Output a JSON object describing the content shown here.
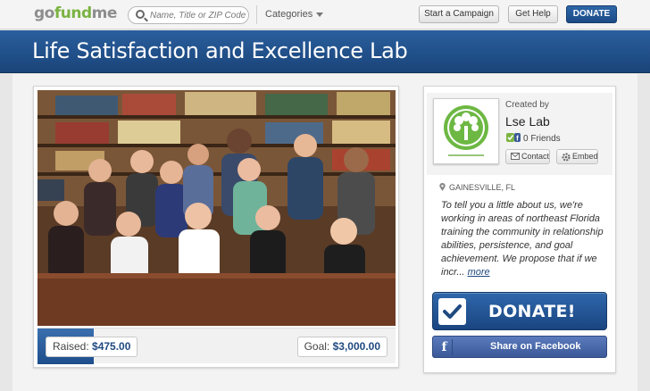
{
  "header": {
    "logo_text_1": "go",
    "logo_text_2": "fund",
    "logo_text_3": "me",
    "search_placeholder": "Name, Title or ZIP Code...",
    "categories_label": "Categories",
    "start_campaign_label": "Start a Campaign",
    "get_help_label": "Get Help",
    "donate_label": "DONATE"
  },
  "campaign": {
    "title": "Life Satisfaction and Excellence Lab",
    "raised_label": "Raised:",
    "raised_amount": "$475.00",
    "goal_label": "Goal:",
    "goal_amount": "$3,000.00",
    "progress_fraction": 0.158
  },
  "creator": {
    "created_by_label": "Created by",
    "name": "Lse Lab",
    "friends_label": "0 Friends",
    "contact_label": "Contact",
    "embed_label": "Embed"
  },
  "story": {
    "location": "GAINESVILLE, FL",
    "text": "To tell you a little about us, we're working in areas of northeast Florida training the community in relationship abilities, persistence, and goal achievement. We propose that if we incr...",
    "more_label": "more"
  },
  "actions": {
    "donate_label": "DONATE!",
    "facebook_label": "Share on Facebook"
  },
  "colors": {
    "brand_blue": "#1f4a80",
    "brand_green": "#7bb342",
    "facebook_blue": "#3b5998"
  },
  "icons": {
    "search": "magnifier-icon",
    "location": "map-pin-icon",
    "facebook": "facebook-f-icon",
    "donate": "checkmark-icon"
  }
}
